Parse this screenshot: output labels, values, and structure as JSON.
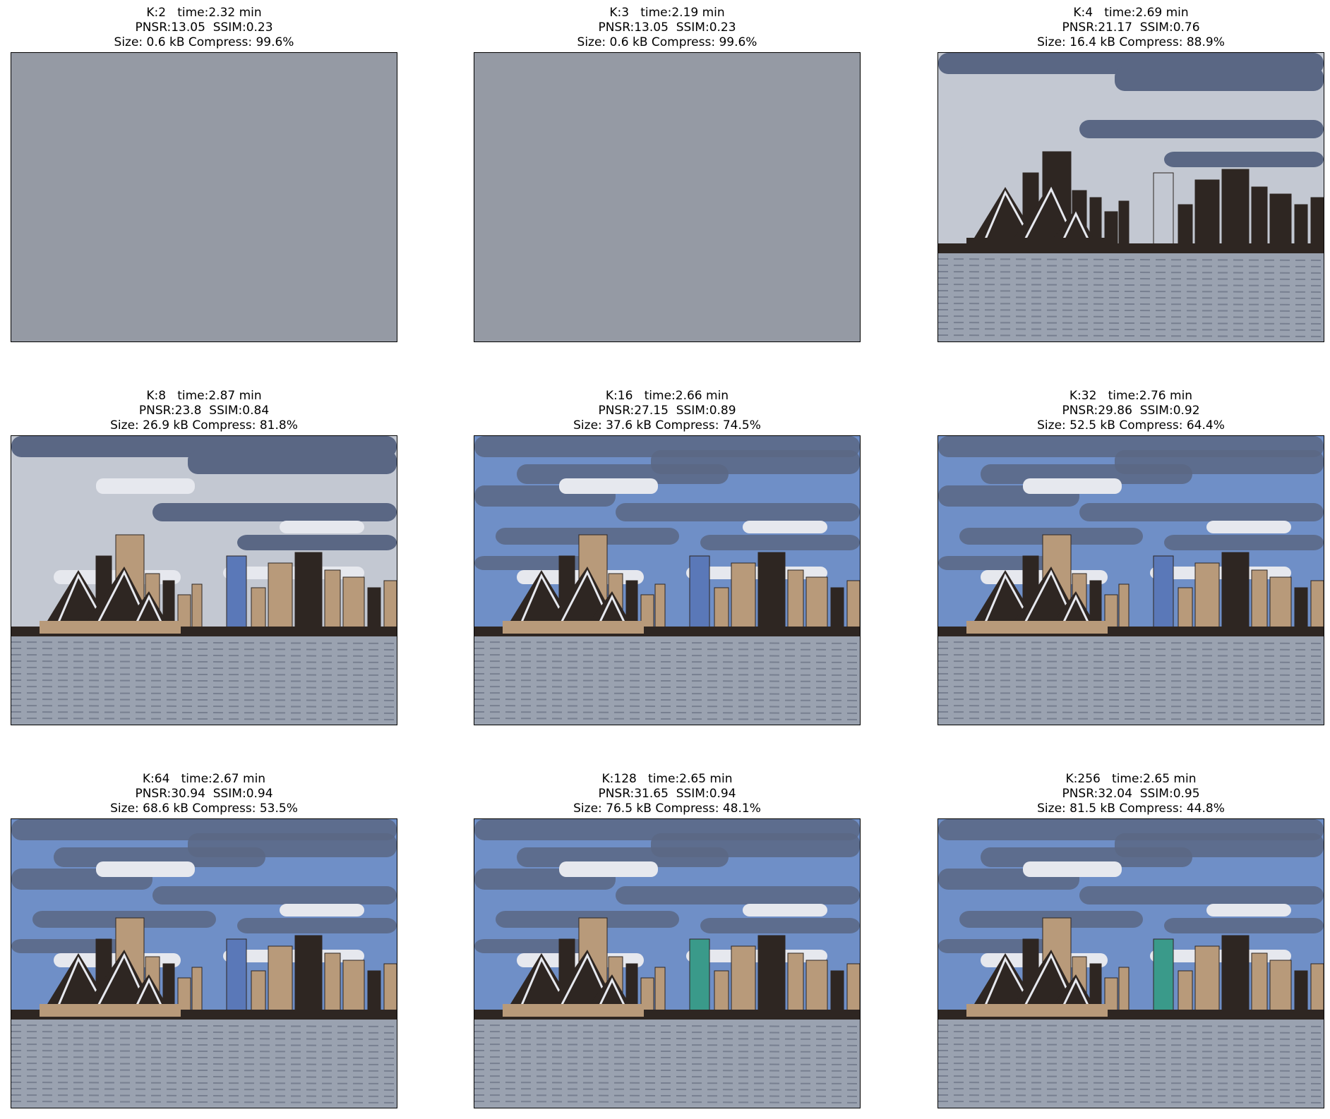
{
  "panels": [
    {
      "k": 2,
      "caption": {
        "line1": "K:2   time:2.32 min",
        "line2": "PNSR:13.05  SSIM:0.23",
        "line3": "Size: 0.6 kB Compress: 99.6%"
      },
      "quality": 0
    },
    {
      "k": 3,
      "caption": {
        "line1": "K:3   time:2.19 min",
        "line2": "PNSR:13.05  SSIM:0.23",
        "line3": "Size: 0.6 kB Compress: 99.6%"
      },
      "quality": 0
    },
    {
      "k": 4,
      "caption": {
        "line1": "K:4   time:2.69 min",
        "line2": "PNSR:21.17  SSIM:0.76",
        "line3": "Size: 16.4 kB Compress: 88.9%"
      },
      "quality": 1
    },
    {
      "k": 8,
      "caption": {
        "line1": "K:8   time:2.87 min",
        "line2": "PNSR:23.8  SSIM:0.84",
        "line3": "Size: 26.9 kB Compress: 81.8%"
      },
      "quality": 2
    },
    {
      "k": 16,
      "caption": {
        "line1": "K:16   time:2.66 min",
        "line2": "PNSR:27.15  SSIM:0.89",
        "line3": "Size: 37.6 kB Compress: 74.5%"
      },
      "quality": 3
    },
    {
      "k": 32,
      "caption": {
        "line1": "K:32   time:2.76 min",
        "line2": "PNSR:29.86  SSIM:0.92",
        "line3": "Size: 52.5 kB Compress: 64.4%"
      },
      "quality": 3
    },
    {
      "k": 64,
      "caption": {
        "line1": "K:64   time:2.67 min",
        "line2": "PNSR:30.94  SSIM:0.94",
        "line3": "Size: 68.6 kB Compress: 53.5%"
      },
      "quality": 4
    },
    {
      "k": 128,
      "caption": {
        "line1": "K:128   time:2.65 min",
        "line2": "PNSR:31.65  SSIM:0.94",
        "line3": "Size: 76.5 kB Compress: 48.1%"
      },
      "quality": 4
    },
    {
      "k": 256,
      "caption": {
        "line1": "K:256   time:2.65 min",
        "line2": "PNSR:32.04  SSIM:0.95",
        "line3": "Size: 81.5 kB Compress: 44.8%"
      },
      "quality": 4
    }
  ],
  "colors": {
    "flat_gray": "#959aa4",
    "sky_dark": "#5a6784",
    "sky_light": "#c3c8d2",
    "sky_blue": "#6f8fc7",
    "cloud_white": "#e6e8ee",
    "building_dark": "#2e2622",
    "building_tan": "#b89a7a",
    "water": "#9aa2b0",
    "water_dark": "#5c6476",
    "glass_blue": "#5a78b8",
    "glass_teal": "#3a9a8a"
  }
}
